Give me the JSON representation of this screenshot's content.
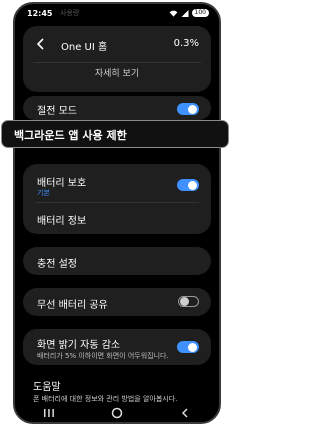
{
  "status_bar": {
    "time": "12:45",
    "battery": "100",
    "faded_title": "사용량"
  },
  "header": {
    "app_name": "One UI 홈",
    "percent": "0.3%",
    "details_label": "자세히 보기"
  },
  "power_saving": {
    "label": "절전 모드",
    "enabled": true
  },
  "background_limit": {
    "label": "백그라운드 앱 사용 제한"
  },
  "battery_protection": {
    "label": "배터리 보호",
    "sublabel": "기본",
    "enabled": true
  },
  "battery_info": {
    "label": "배터리 정보"
  },
  "charging_settings": {
    "label": "충전 설정"
  },
  "wireless_share": {
    "label": "무선 배터리 공유",
    "enabled": false
  },
  "auto_dim": {
    "label": "화면 밝기 자동 감소",
    "sublabel": "배터리가 5% 이하이면 화면이 어두워집니다.",
    "enabled": true
  },
  "help": {
    "title": "도움말",
    "text": "폰 배터리에 대한 정보와 관리 방법을 알아봅시다."
  },
  "colors": {
    "accent": "#3e91ff",
    "card": "#1f1f1f",
    "background": "#000000"
  }
}
